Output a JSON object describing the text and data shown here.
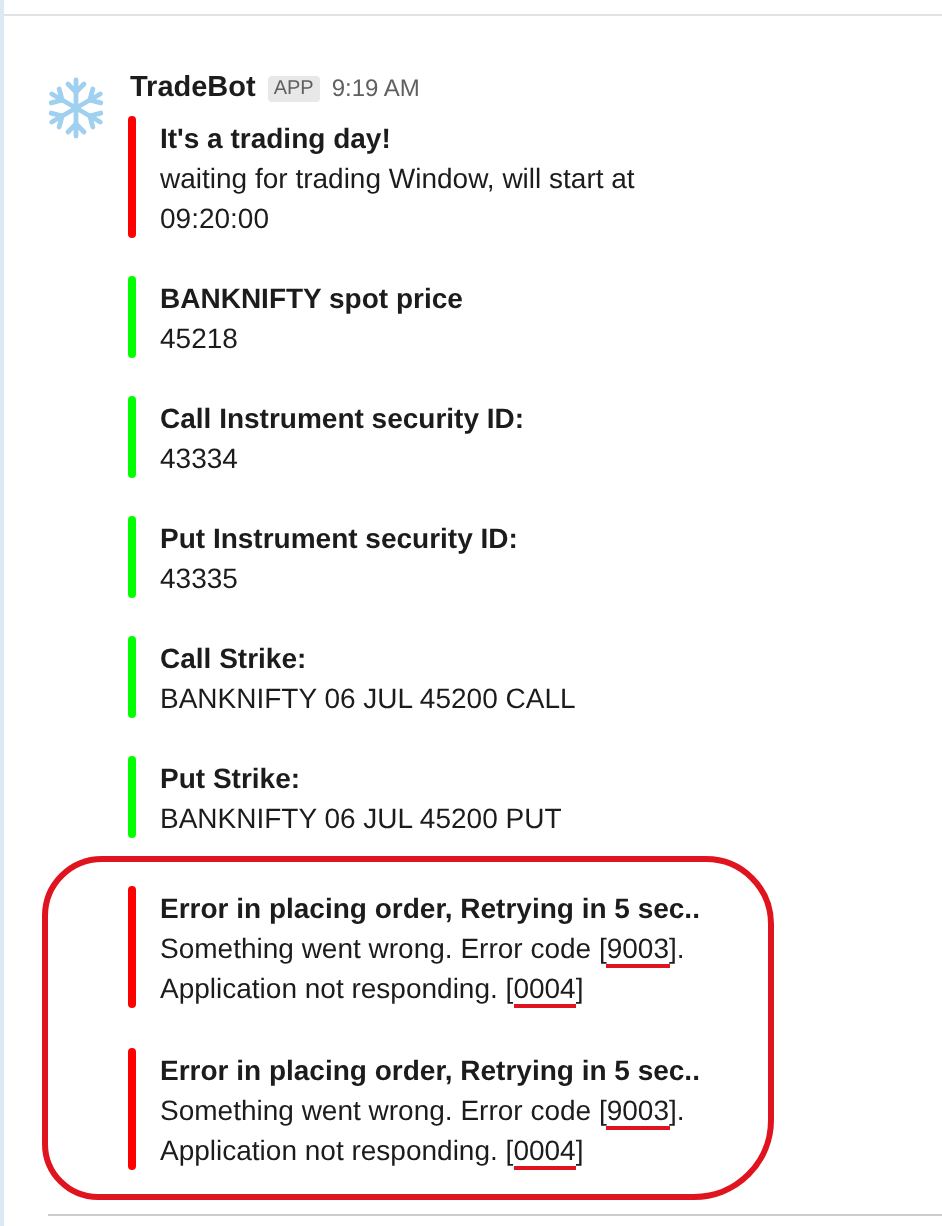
{
  "message": {
    "sender": "TradeBot",
    "badge": "APP",
    "time": "9:19 AM",
    "attachments": [
      {
        "color": "#ff0000",
        "circled": false,
        "title": "It's a trading day!",
        "lines": [
          [
            {
              "text": "waiting for trading Window, will start at"
            }
          ],
          [
            {
              "text": "09:20:00"
            }
          ]
        ]
      },
      {
        "color": "#00ff00",
        "circled": false,
        "title": "BANKNIFTY spot price",
        "lines": [
          [
            {
              "text": "45218"
            }
          ]
        ]
      },
      {
        "color": "#00ff00",
        "circled": false,
        "title": "Call Instrument security ID:",
        "lines": [
          [
            {
              "text": "43334"
            }
          ]
        ]
      },
      {
        "color": "#00ff00",
        "circled": false,
        "title": "Put Instrument security ID:",
        "lines": [
          [
            {
              "text": "43335"
            }
          ]
        ]
      },
      {
        "color": "#00ff00",
        "circled": false,
        "title": "Call Strike:",
        "lines": [
          [
            {
              "text": "BANKNIFTY 06 JUL 45200 CALL"
            }
          ]
        ]
      },
      {
        "color": "#00ff00",
        "circled": false,
        "title": "Put Strike:",
        "lines": [
          [
            {
              "text": "BANKNIFTY 06 JUL 45200 PUT"
            }
          ]
        ]
      },
      {
        "color": "#ff0000",
        "circled": true,
        "title": "Error in placing order, Retrying in 5 sec..",
        "lines": [
          [
            {
              "text": "Something went wrong. Error code ["
            },
            {
              "text": "9003",
              "underlined": true
            },
            {
              "text": "]."
            }
          ],
          [
            {
              "text": "Application not responding. ["
            },
            {
              "text": "0004",
              "underlined": true
            },
            {
              "text": "]"
            }
          ]
        ]
      },
      {
        "color": "#ff0000",
        "circled": true,
        "title": "Error in placing order, Retrying in 5 sec..",
        "lines": [
          [
            {
              "text": "Something went wrong. Error code ["
            },
            {
              "text": "9003",
              "underlined": true
            },
            {
              "text": "]."
            }
          ],
          [
            {
              "text": "Application not responding. ["
            },
            {
              "text": "0004",
              "underlined": true
            },
            {
              "text": "]"
            }
          ]
        ]
      }
    ]
  }
}
